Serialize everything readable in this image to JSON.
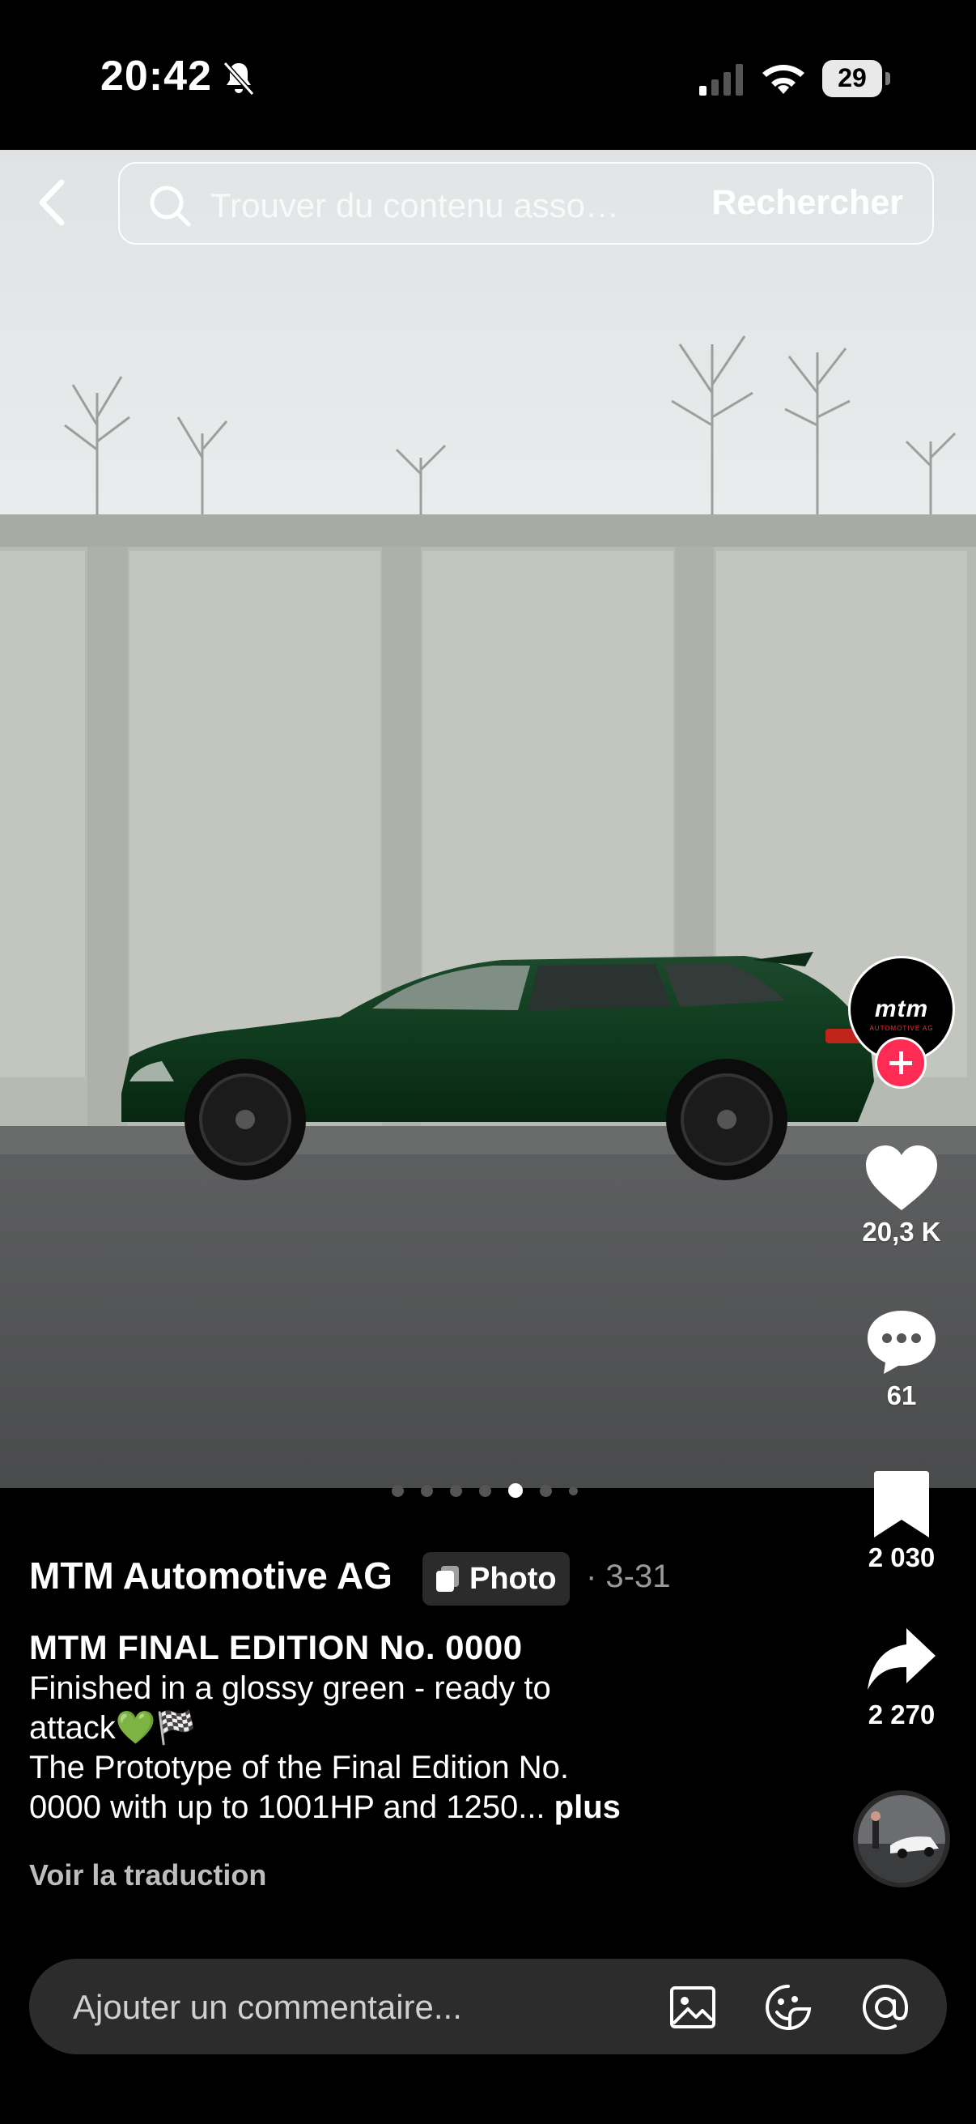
{
  "status_bar": {
    "time": "20:42",
    "battery": "29"
  },
  "search": {
    "placeholder": "Trouver du contenu asso…",
    "button_label": "Rechercher"
  },
  "post": {
    "author": "MTM Automotive AG",
    "type_badge": "Photo",
    "date": "· 3-31",
    "title": "MTM FINAL EDITION No. 0000",
    "caption_line1": "Finished in a glossy green - ready to",
    "caption_line2": "attack💚🏁",
    "caption_line3": "The Prototype of the Final Edition No.",
    "caption_line4": "0000 with up to 1001HP and 1250...",
    "more_label": "plus",
    "translate_label": "Voir la traduction",
    "carousel": {
      "count": 7,
      "active_index": 4
    }
  },
  "profile": {
    "logo_text": "mtm",
    "logo_sub": "AUTOMOTIVE AG"
  },
  "actions": {
    "likes": "20,3 K",
    "comments": "61",
    "bookmarks": "2 030",
    "shares": "2 270"
  },
  "comment": {
    "placeholder": "Ajouter un commentaire..."
  }
}
